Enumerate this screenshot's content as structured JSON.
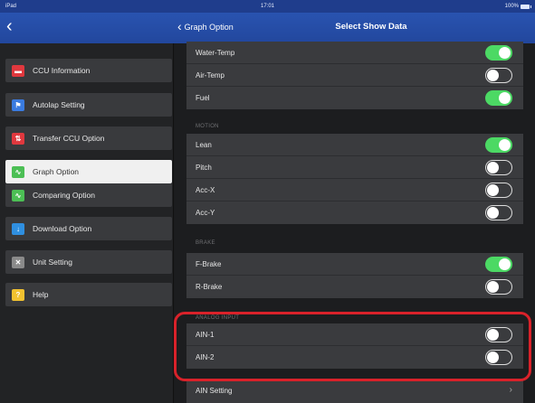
{
  "status_bar": {
    "carrier": "iPad",
    "time": "17:01",
    "battery": "100%"
  },
  "nav": {
    "back_root": "‹",
    "back_label": "Graph Option",
    "title": "Select Show Data"
  },
  "sidebar": {
    "items": [
      {
        "label": "CCU Information",
        "icon": "car-icon",
        "color": "#e0383e",
        "glyph": "▬",
        "selected": false
      },
      {
        "label": "Autolap Setting",
        "icon": "flag-icon",
        "color": "#3a7be0",
        "glyph": "⚑",
        "selected": false
      },
      {
        "label": "Transfer CCU Option",
        "icon": "transfer-icon",
        "color": "#e0383e",
        "glyph": "⇅",
        "selected": false
      },
      {
        "label": "Graph Option",
        "icon": "graph-icon",
        "color": "#4cbf55",
        "glyph": "∿",
        "selected": true
      },
      {
        "label": "Comparing Option",
        "icon": "compare-graph-icon",
        "color": "#4cbf55",
        "glyph": "∿",
        "selected": false
      },
      {
        "label": "Download Option",
        "icon": "download-icon",
        "color": "#2f8fe0",
        "glyph": "↓",
        "selected": false
      },
      {
        "label": "Unit Setting",
        "icon": "tools-icon",
        "color": "#8a8a8a",
        "glyph": "✕",
        "selected": false
      },
      {
        "label": "Help",
        "icon": "help-icon",
        "color": "#f2c230",
        "glyph": "?",
        "selected": false
      }
    ]
  },
  "groups": {
    "engine": [
      {
        "label": "Water-Temp",
        "on": true
      },
      {
        "label": "Air-Temp",
        "on": false
      },
      {
        "label": "Fuel",
        "on": true
      }
    ],
    "motion_header": "MOTION",
    "motion": [
      {
        "label": "Lean",
        "on": true
      },
      {
        "label": "Pitch",
        "on": false
      },
      {
        "label": "Acc-X",
        "on": false
      },
      {
        "label": "Acc-Y",
        "on": false
      }
    ],
    "brake_header": "BRAKE",
    "brake": [
      {
        "label": "F-Brake",
        "on": true
      },
      {
        "label": "R-Brake",
        "on": false
      }
    ],
    "analog_header": "ANALOG INPUT",
    "analog": [
      {
        "label": "AIN-1",
        "on": false
      },
      {
        "label": "AIN-2",
        "on": false
      }
    ],
    "ain_setting": "AIN Setting"
  },
  "colors": {
    "toggle_on": "#4cd964",
    "nav_blue": "#22479d",
    "highlight_red": "#d9222a"
  }
}
